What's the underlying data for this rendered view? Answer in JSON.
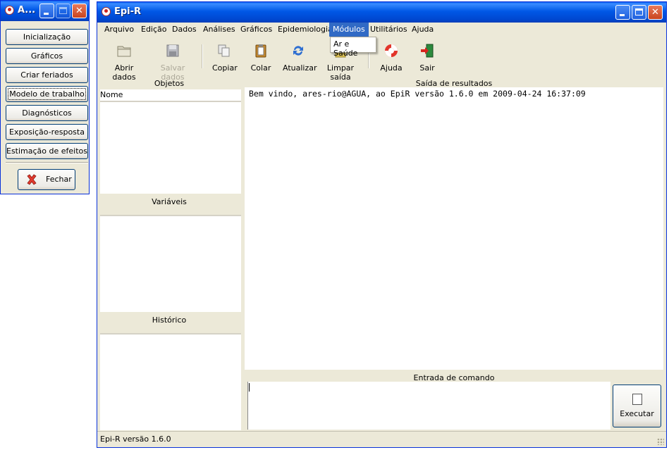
{
  "panel_window": {
    "title": "A...",
    "buttons": [
      "Inicialização",
      "Gráficos",
      "Criar feriados",
      "Modelo de trabalho",
      "Diagnósticos",
      "Exposição-resposta",
      "Estimação de efeitos"
    ],
    "close_label": "Fechar"
  },
  "main_window": {
    "title": "Epi-R",
    "menu": [
      "Arquivo",
      "Edição",
      "Dados",
      "Análises",
      "Gráficos",
      "Epidemiologia",
      "Módulos",
      "Utilitários",
      "Ajuda"
    ],
    "active_menu": "Módulos",
    "dropdown_items": [
      "Ar e Saúde"
    ],
    "toolbar": [
      {
        "label": "Abrir dados",
        "icon": "folder-icon",
        "enabled": true
      },
      {
        "label": "Salvar dados",
        "icon": "floppy-icon",
        "enabled": false
      },
      {
        "label": "Copiar",
        "icon": "copy-icon",
        "enabled": true
      },
      {
        "label": "Colar",
        "icon": "paste-icon",
        "enabled": true
      },
      {
        "label": "Atualizar",
        "icon": "refresh-icon",
        "enabled": true
      },
      {
        "label": "Limpar saída",
        "icon": "eraser-icon",
        "enabled": true
      },
      {
        "label": "Ajuda",
        "icon": "lifebuoy-icon",
        "enabled": true
      },
      {
        "label": "Sair",
        "icon": "exit-door-icon",
        "enabled": true
      }
    ],
    "objects_header": "Objetos",
    "objects_column": "Nome",
    "variables_header": "Variáveis",
    "history_header": "Histórico",
    "output_header": "Saída de resultados",
    "output_text": "Bem vindo, ares-rio@AGUA, ao EpiR versão 1.6.0 em 2009-04-24 16:37:09",
    "command_header": "Entrada de comando",
    "command_value": "",
    "execute_label": "Executar",
    "status": "Epi-R versão 1.6.0"
  }
}
